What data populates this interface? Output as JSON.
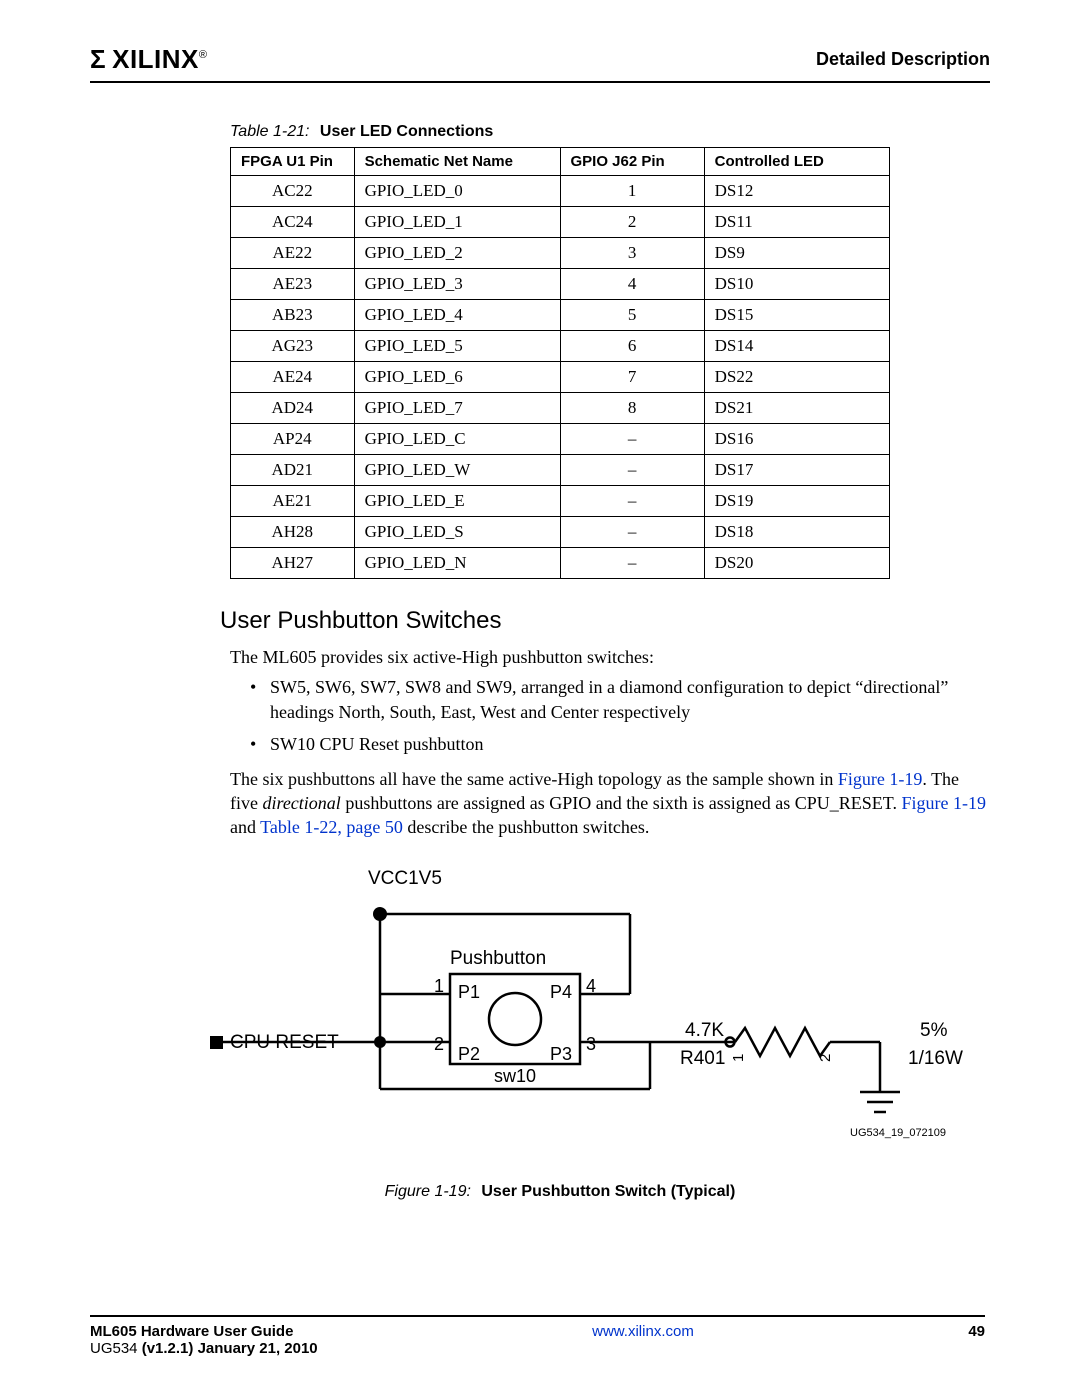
{
  "header": {
    "logo_mark": "Σ",
    "logo_text": "XILINX",
    "right": "Detailed Description"
  },
  "table_caption": {
    "label": "Table 1-21:",
    "title": "User LED Connections"
  },
  "table_headers": [
    "FPGA U1 Pin",
    "Schematic Net Name",
    "GPIO J62 Pin",
    "Controlled LED"
  ],
  "table_rows": [
    [
      "AC22",
      "GPIO_LED_0",
      "1",
      "DS12"
    ],
    [
      "AC24",
      "GPIO_LED_1",
      "2",
      "DS11"
    ],
    [
      "AE22",
      "GPIO_LED_2",
      "3",
      "DS9"
    ],
    [
      "AE23",
      "GPIO_LED_3",
      "4",
      "DS10"
    ],
    [
      "AB23",
      "GPIO_LED_4",
      "5",
      "DS15"
    ],
    [
      "AG23",
      "GPIO_LED_5",
      "6",
      "DS14"
    ],
    [
      "AE24",
      "GPIO_LED_6",
      "7",
      "DS22"
    ],
    [
      "AD24",
      "GPIO_LED_7",
      "8",
      "DS21"
    ],
    [
      "AP24",
      "GPIO_LED_C",
      "–",
      "DS16"
    ],
    [
      "AD21",
      "GPIO_LED_W",
      "–",
      "DS17"
    ],
    [
      "AE21",
      "GPIO_LED_E",
      "–",
      "DS19"
    ],
    [
      "AH28",
      "GPIO_LED_S",
      "–",
      "DS18"
    ],
    [
      "AH27",
      "GPIO_LED_N",
      "–",
      "DS20"
    ]
  ],
  "section_heading": "User Pushbutton Switches",
  "p1": "The ML605 provides six active-High pushbutton switches:",
  "bullets": [
    "SW5, SW6, SW7, SW8 and SW9, arranged in a diamond configuration to depict “directional” headings North, South, East, West and Center respectively",
    "SW10 CPU Reset pushbutton"
  ],
  "p2a": "The six pushbuttons all have the same active-High topology as the sample shown in ",
  "p2_link1": "Figure 1-19",
  "p2b": ". The five ",
  "p2_italic": "directional",
  "p2c": " pushbuttons are assigned as GPIO and the sixth is assigned as CPU_RESET. ",
  "p2_link2": "Figure 1-19",
  "p2d": " and ",
  "p2_link3": "Table 1-22, page 50",
  "p2e": " describe the pushbutton switches.",
  "figure": {
    "vcc": "VCC1V5",
    "pb": "Pushbutton",
    "p1": "P1",
    "p2": "P2",
    "p3": "P3",
    "p4": "P4",
    "n1": "1",
    "n2": "2",
    "n3": "3",
    "n4": "4",
    "cpu_reset": "CPU RESET",
    "sw": "sw10",
    "rname": "R401",
    "rval": "4.7K",
    "rpct": "5%",
    "rpwr": "1/16W",
    "rpin1": "1",
    "rpin2": "2",
    "figid": "UG534_19_072109"
  },
  "figure_caption": {
    "label": "Figure 1-19:",
    "title": "User Pushbutton Switch (Typical)"
  },
  "footer": {
    "title": "ML605 Hardware User Guide",
    "sub_prefix": "UG534  ",
    "sub_bold": "(v1.2.1) January 21, 2010",
    "url": "www.xilinx.com",
    "page": "49"
  }
}
